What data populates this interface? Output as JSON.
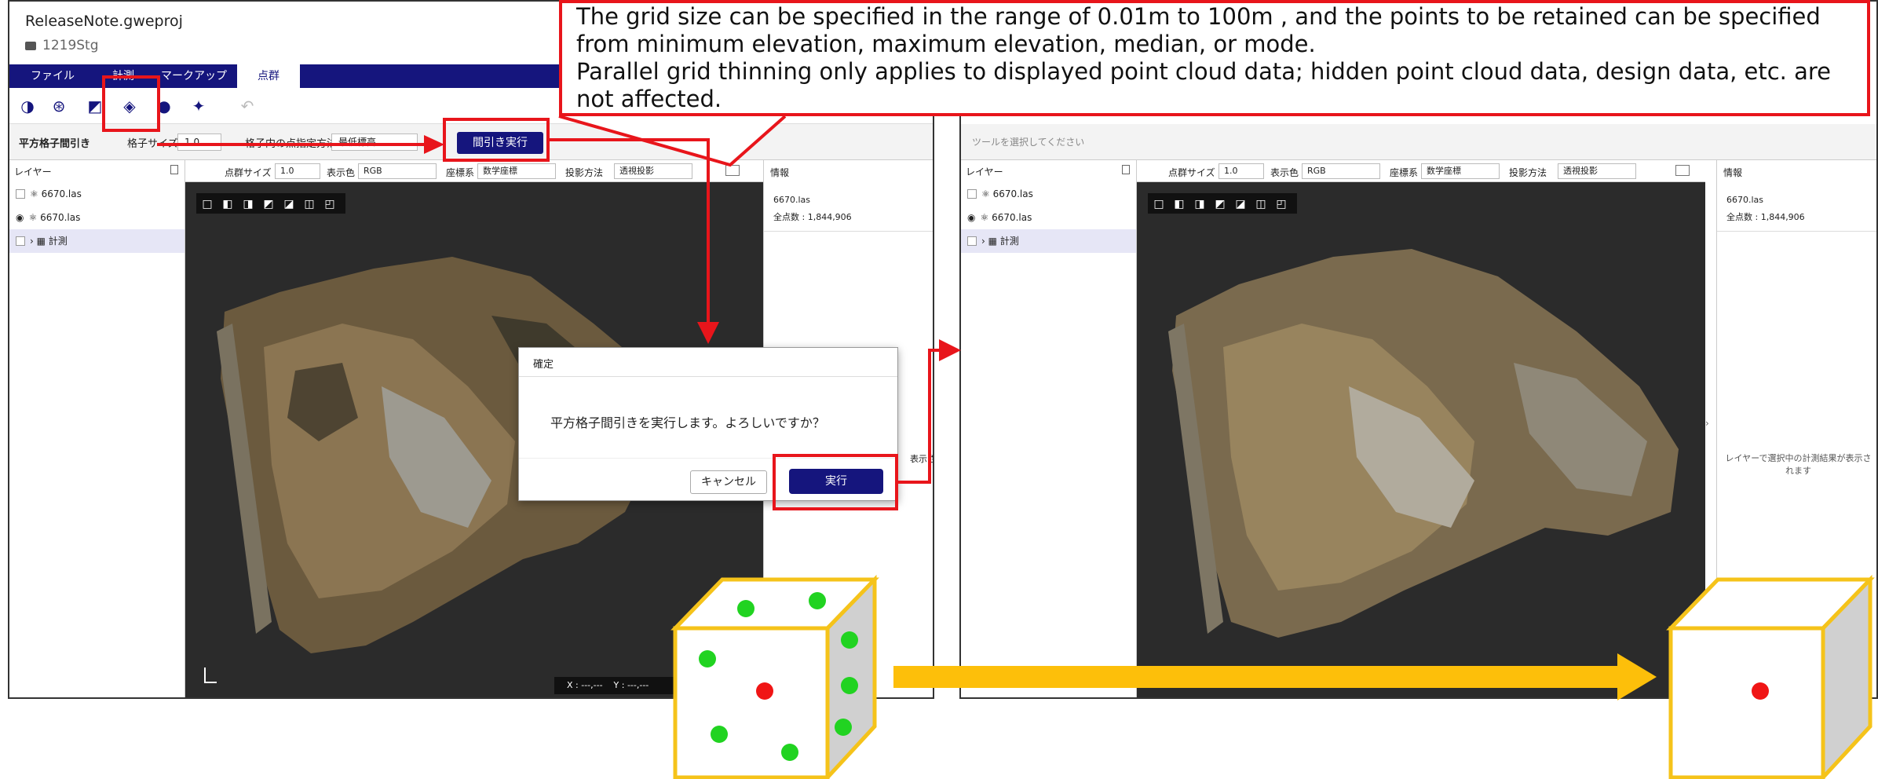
{
  "window": {
    "project_name": "ReleaseNote.gweproj",
    "project_sub": "1219Stg",
    "ribbon_tabs": [
      "ファイル",
      "計測",
      "マークアップ",
      "点群"
    ],
    "tool_hint": "ツールを選択してください"
  },
  "options": {
    "title": "平方格子間引き",
    "grid_size_label": "格子サイズ",
    "grid_size_value": "1.0",
    "point_method_label": "格子内の点指定方法",
    "point_method_value": "最低標高",
    "execute_button": "間引き実行"
  },
  "layers": {
    "header": "レイヤー",
    "items": [
      {
        "name": "6670.las"
      },
      {
        "name": "6670.las"
      },
      {
        "name": "計測"
      }
    ]
  },
  "viewbar": {
    "point_size_label": "点群サイズ",
    "point_size_value": "1.0",
    "color_label": "表示色",
    "color_value": "RGB",
    "coord_label": "座標系",
    "coord_value": "数学座標",
    "projection_label": "投影方法",
    "projection_value": "透視投影"
  },
  "info": {
    "header": "情報",
    "file": "6670.las",
    "point_count": "全点数 : 1,844,906",
    "hint": "レイヤーで選択中の計測結果が表示されます",
    "hint_left_partial": "表示さ"
  },
  "coords": {
    "x": "X : ---,---",
    "y": "Y : ---,---"
  },
  "dialog": {
    "title": "確定",
    "message": "平方格子間引きを実行します。よろしいですか？",
    "cancel": "キャンセル",
    "ok": "実行"
  },
  "callout": {
    "line1": "The grid size can be specified in the range of 0.01m to 100m , and the points to be retained can be specified from minimum elevation, maximum elevation, median, or mode.",
    "line2": "Parallel grid thinning only applies to displayed point cloud data; hidden point cloud data, design data, etc. are not affected."
  },
  "colors": {
    "accent": "#15157d",
    "annotation_red": "#e8151b",
    "arrow_yellow": "#fdbf0a",
    "cube_border": "#f5c31a",
    "dot_green": "#21d321",
    "dot_red": "#f01515"
  }
}
